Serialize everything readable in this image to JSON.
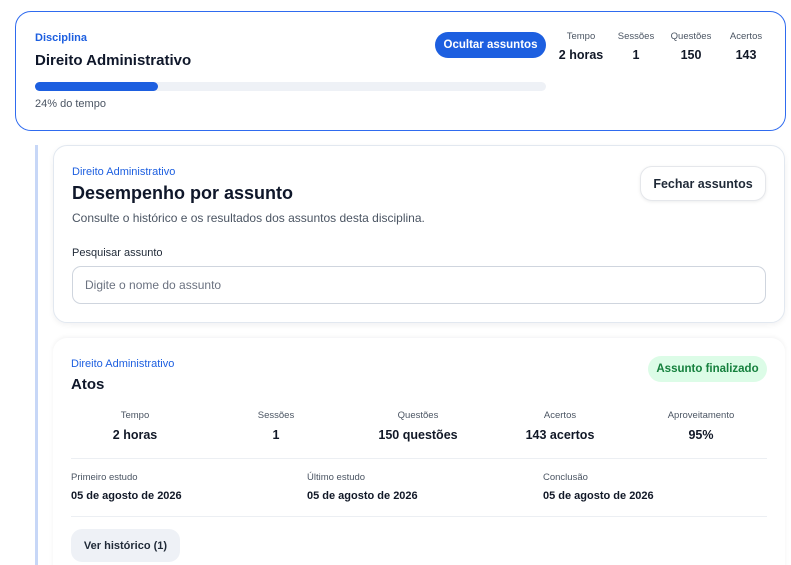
{
  "discipline": {
    "label": "Disciplina",
    "title": "Direito Administrativo",
    "progress_fraction": 0.24,
    "progress_text": "24% do tempo",
    "toggle_button": "Ocultar assuntos",
    "stats": [
      {
        "label": "Tempo",
        "value": "2 horas"
      },
      {
        "label": "Sessões",
        "value": "1"
      },
      {
        "label": "Questões",
        "value": "150"
      },
      {
        "label": "Acertos",
        "value": "143"
      }
    ]
  },
  "performance": {
    "kicker": "Direito Administrativo",
    "title": "Desempenho por assunto",
    "subtitle": "Consulte o histórico e os resultados dos assuntos desta disciplina.",
    "close_button": "Fechar assuntos",
    "search_label": "Pesquisar assunto",
    "search_value": "",
    "search_placeholder": "Digite o nome do assunto"
  },
  "topic": {
    "kicker": "Direito Administrativo",
    "title": "Atos",
    "badge": "Assunto finalizado",
    "badge_color": "#15803d",
    "metrics": [
      {
        "label": "Tempo",
        "value": "2 horas"
      },
      {
        "label": "Sessões",
        "value": "1"
      },
      {
        "label": "Questões",
        "value": "150 questões"
      },
      {
        "label": "Acertos",
        "value": "143 acertos"
      },
      {
        "label": "Aproveitamento",
        "value": "95%"
      }
    ],
    "dates": [
      {
        "label": "Primeiro estudo",
        "value": "05 de agosto de 2026"
      },
      {
        "label": "Último estudo",
        "value": "05 de agosto de 2026"
      },
      {
        "label": "Conclusão",
        "value": "05 de agosto de 2026"
      }
    ],
    "history_button": "Ver histórico (1)"
  },
  "colors": {
    "accent": "#1d5fe0",
    "success_bg": "#dcfce7",
    "success_text": "#15803d"
  }
}
